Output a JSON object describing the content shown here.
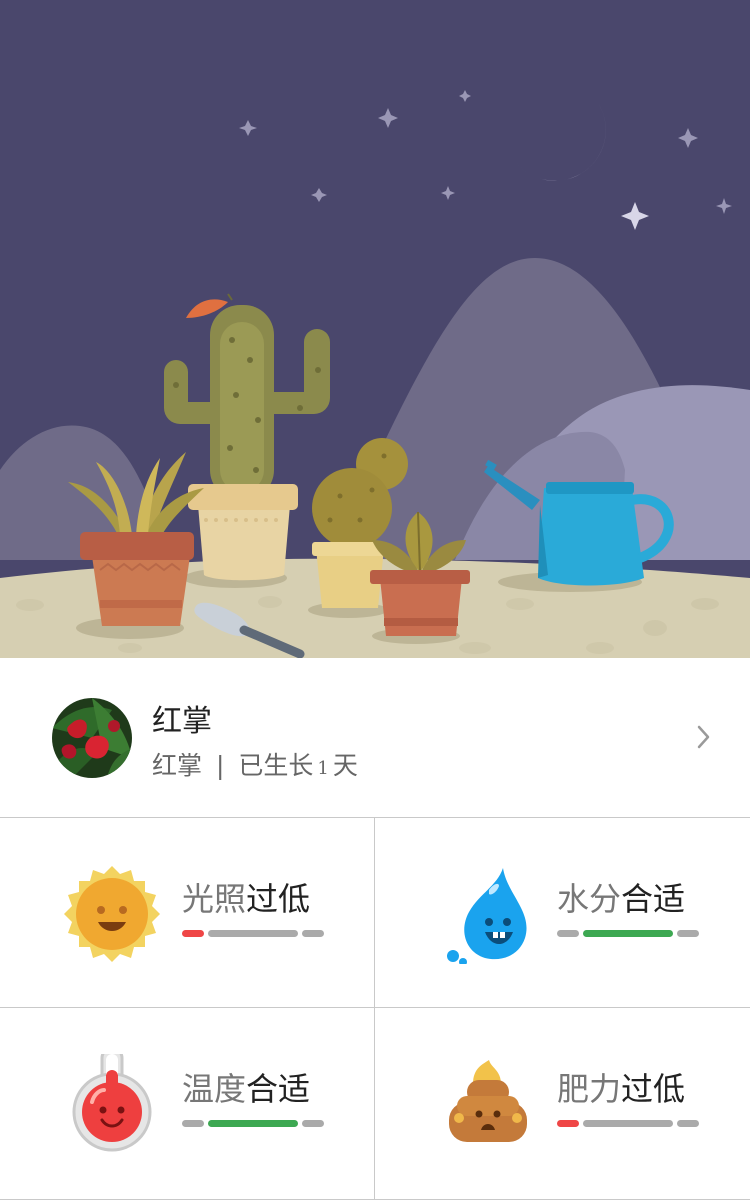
{
  "plant": {
    "name": "红掌",
    "sub_name": "红掌",
    "separator": "|",
    "age_prefix": "已生长",
    "age_days": "1",
    "age_suffix": "天"
  },
  "stats": [
    {
      "key": "光照",
      "status": "过低",
      "level": "low",
      "icon": "sun-icon"
    },
    {
      "key": "水分",
      "status": "合适",
      "level": "ok",
      "icon": "water-drop-icon"
    },
    {
      "key": "温度",
      "status": "合适",
      "level": "ok",
      "icon": "thermometer-icon"
    },
    {
      "key": "肥力",
      "status": "过低",
      "level": "low",
      "icon": "fertilizer-icon"
    }
  ],
  "colors": {
    "sky": "#4a476c",
    "ground": "#d6cfb2",
    "low": "#ef4646",
    "ok": "#3da852",
    "neutral": "#aaaaaa"
  }
}
